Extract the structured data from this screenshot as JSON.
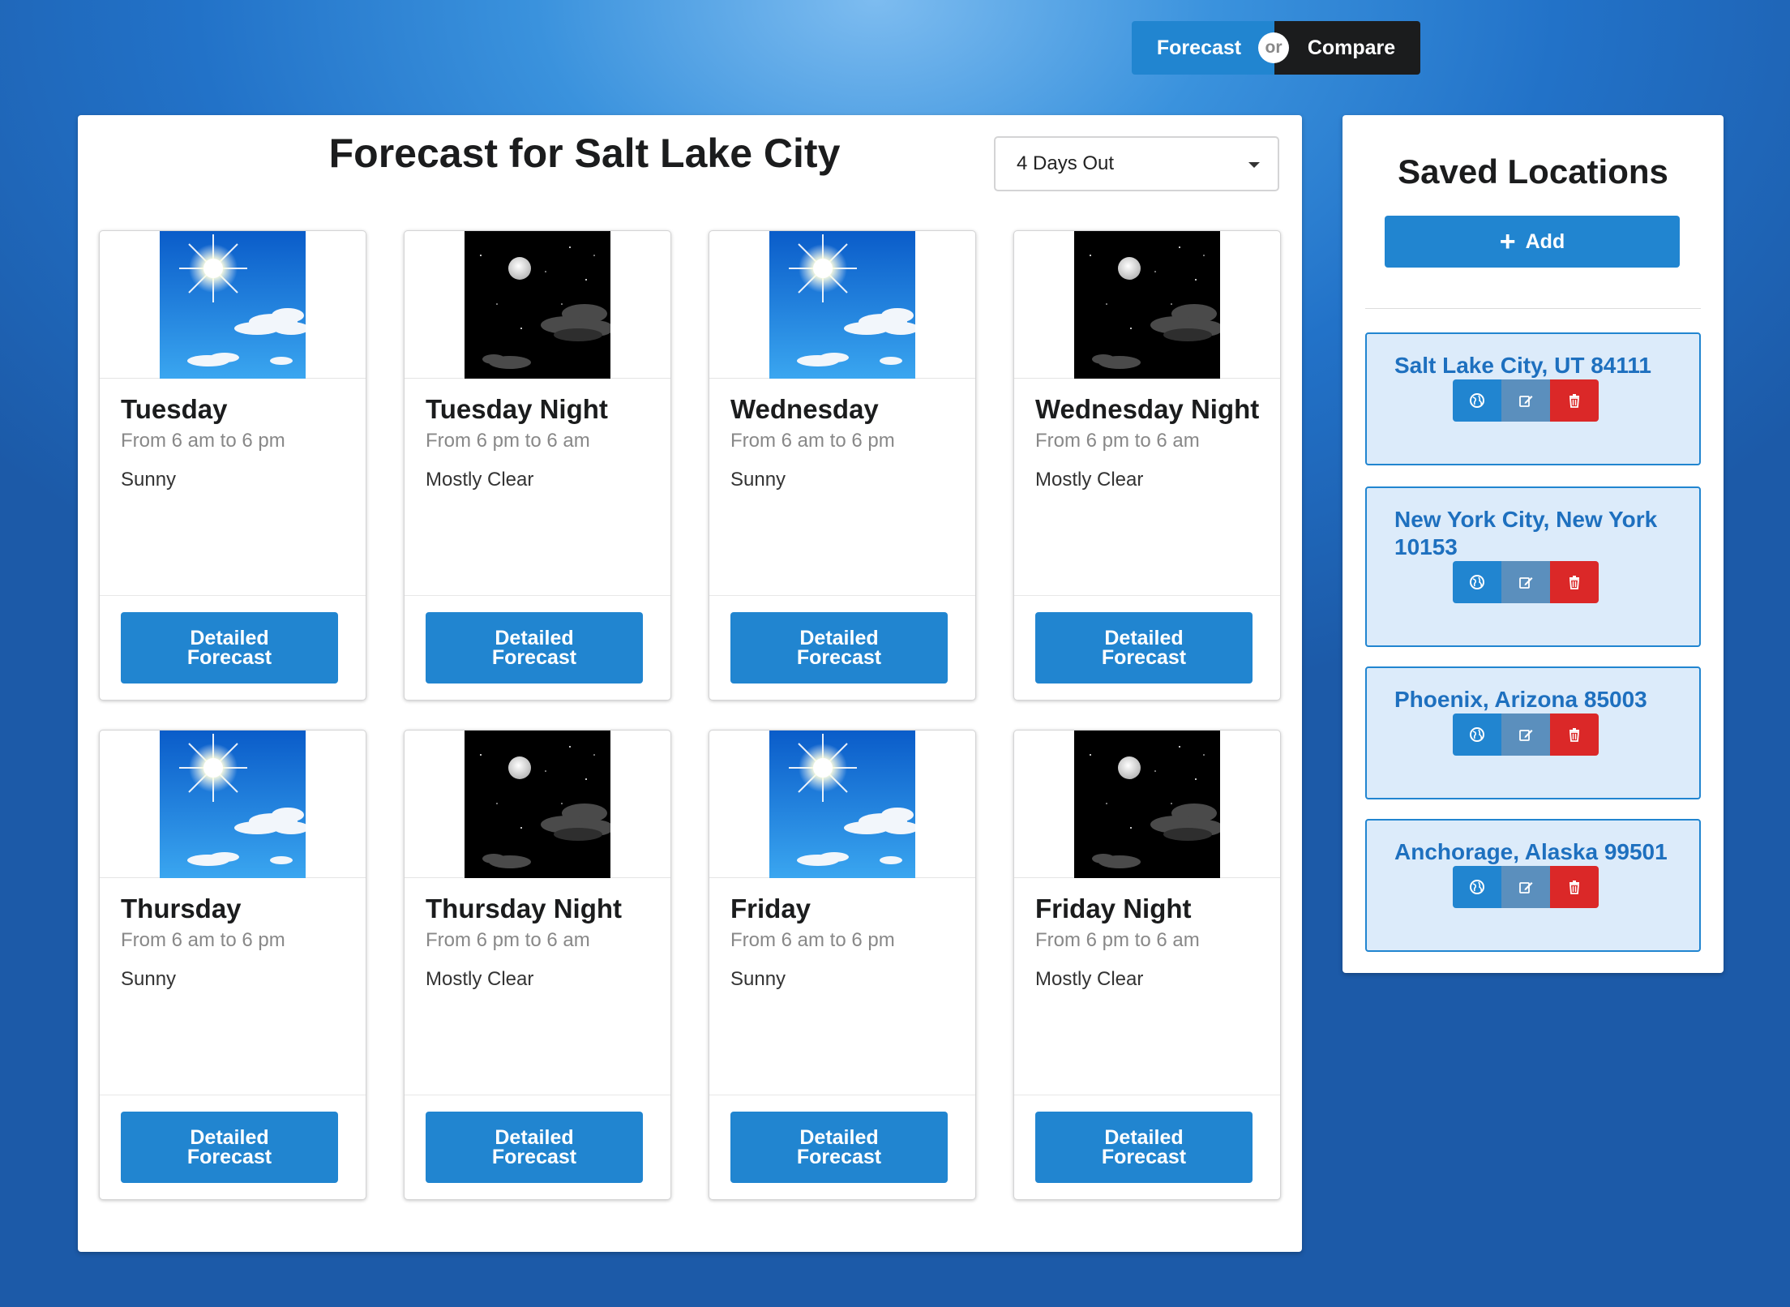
{
  "toggle": {
    "forecast_label": "Forecast",
    "or_label": "or",
    "compare_label": "Compare"
  },
  "main": {
    "title": "Forecast for Salt Lake City",
    "days_select": {
      "selected": "4 Days Out"
    },
    "cards": [
      {
        "title": "Tuesday",
        "time": "From 6 am to 6 pm",
        "condition": "Sunny",
        "icon": "sunny-icon",
        "button": "Detailed Forecast"
      },
      {
        "title": "Tuesday Night",
        "time": "From 6 pm to 6 am",
        "condition": "Mostly Clear",
        "icon": "night-clear-icon",
        "button": "Detailed Forecast"
      },
      {
        "title": "Wednesday",
        "time": "From 6 am to 6 pm",
        "condition": "Sunny",
        "icon": "sunny-icon",
        "button": "Detailed Forecast"
      },
      {
        "title": "Wednesday Night",
        "time": "From 6 pm to 6 am",
        "condition": "Mostly Clear",
        "icon": "night-clear-icon",
        "button": "Detailed Forecast"
      },
      {
        "title": "Thursday",
        "time": "From 6 am to 6 pm",
        "condition": "Sunny",
        "icon": "sunny-icon",
        "button": "Detailed Forecast"
      },
      {
        "title": "Thursday Night",
        "time": "From 6 pm to 6 am",
        "condition": "Mostly Clear",
        "icon": "night-clear-icon",
        "button": "Detailed Forecast"
      },
      {
        "title": "Friday",
        "time": "From 6 am to 6 pm",
        "condition": "Sunny",
        "icon": "sunny-icon",
        "button": "Detailed Forecast"
      },
      {
        "title": "Friday Night",
        "time": "From 6 pm to 6 am",
        "condition": "Mostly Clear",
        "icon": "night-clear-icon",
        "button": "Detailed Forecast"
      }
    ]
  },
  "sidebar": {
    "title": "Saved Locations",
    "add_label": "Add",
    "locations": [
      {
        "name": "Salt Lake City, UT 84111"
      },
      {
        "name": "New York City, New York 10153"
      },
      {
        "name": "Phoenix, Arizona 85003"
      },
      {
        "name": "Anchorage, Alaska 99501"
      }
    ]
  },
  "colors": {
    "primary": "#2185d0",
    "danger": "#db2828",
    "edit": "#5b8fbd",
    "location_bg": "#dcebfa",
    "dark": "#1b1c1d"
  }
}
